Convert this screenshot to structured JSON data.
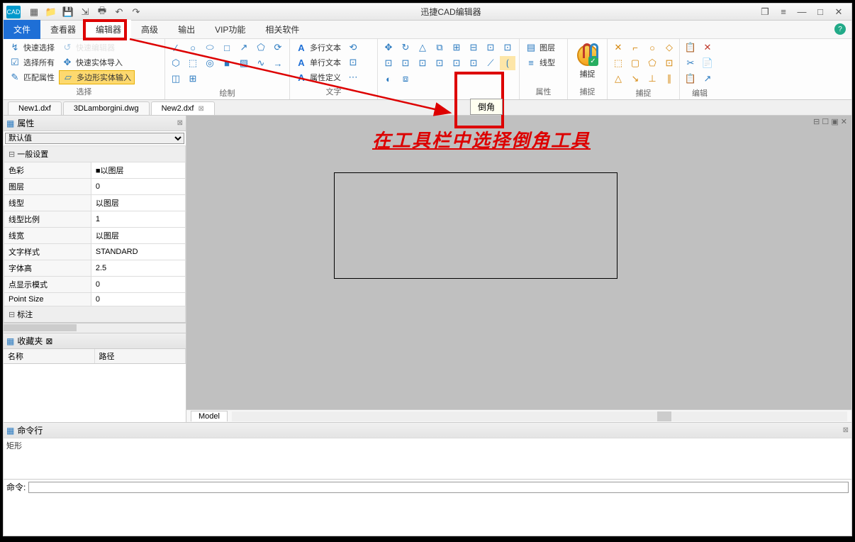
{
  "app": {
    "title": "迅捷CAD编辑器",
    "logo_text": "CAD"
  },
  "qat": [
    "new-icon",
    "open-icon",
    "save-icon",
    "export-icon",
    "print-icon",
    "undo-icon",
    "redo-icon"
  ],
  "win_controls": {
    "panel": "❐",
    "menu": "≡",
    "min": "—",
    "restore": "□",
    "close": "✕"
  },
  "menu": {
    "file": "文件",
    "tabs": [
      "查看器",
      "编辑器",
      "高级",
      "输出",
      "VIP功能",
      "相关软件"
    ],
    "active_index": 1
  },
  "ribbon": {
    "groups": [
      {
        "label": "选择",
        "items_col1": [
          {
            "icon": "↯",
            "text": "快速选择"
          },
          {
            "icon": "☑",
            "text": "选择所有"
          },
          {
            "icon": "✎",
            "text": "匹配属性"
          }
        ],
        "items_col2": [
          {
            "icon": "↺",
            "text": "",
            "dim": true
          },
          {
            "icon": "✥",
            "text": "快速实体导入"
          },
          {
            "icon": "▱",
            "text": "多边形实体输入",
            "selected": true
          }
        ]
      },
      {
        "label": "绘制",
        "icons": [
          "∕",
          "○",
          "⬭",
          "□",
          "↗",
          "⬠",
          "⟳",
          "⬡",
          "⬚",
          "⊗",
          "⬛",
          "▨",
          "∿",
          "∕",
          "◫",
          "⊞"
        ]
      },
      {
        "label": "文字",
        "items": [
          {
            "icon": "A",
            "text": "多行文本"
          },
          {
            "icon": "A",
            "text": "单行文本"
          },
          {
            "icon": "A",
            "text": "属性定义"
          }
        ],
        "side_icons": [
          "⟲",
          "⊡",
          "⋯"
        ]
      },
      {
        "label": "",
        "icons": [
          "✥",
          "↻",
          "⟲",
          "⧉",
          "⊡",
          "⊞",
          "⊟",
          "⊡",
          "⊡",
          "⊡",
          "∕",
          "⟋",
          "⊡",
          "⊡",
          "⊡",
          "⟮",
          "◐",
          "⧈"
        ]
      },
      {
        "label": "属性",
        "items": [
          {
            "icon": "▤",
            "text": "图层"
          },
          {
            "icon": "≡",
            "text": "线型"
          }
        ]
      },
      {
        "label": "捕捉",
        "big_label": "捕捉"
      },
      {
        "label": "捕捉",
        "icons": [
          "✕",
          "⌐",
          "○",
          "◇",
          "⬚",
          "▢",
          "⬠",
          "⊡",
          "△",
          "↘",
          "⊥",
          "∥"
        ]
      },
      {
        "label": "编辑",
        "icons": [
          "📋",
          "✕",
          "✂",
          "📄",
          "📋",
          "↗"
        ]
      }
    ]
  },
  "tooltip": {
    "text": "倒角"
  },
  "filetabs": [
    {
      "name": "New1.dxf",
      "active": false
    },
    {
      "name": "3DLamborgini.dwg",
      "active": false
    },
    {
      "name": "New2.dxf",
      "active": true
    }
  ],
  "properties_panel": {
    "title": "属性",
    "dropdown": "默认值",
    "group1_title": "一般设置",
    "rows": [
      {
        "k": "色彩",
        "v": "■以图层"
      },
      {
        "k": "图层",
        "v": "0"
      },
      {
        "k": "线型",
        "v": "以图层"
      },
      {
        "k": "线型比例",
        "v": "1"
      },
      {
        "k": "线宽",
        "v": "以图层"
      },
      {
        "k": "文字样式",
        "v": "STANDARD"
      },
      {
        "k": "字体高",
        "v": "2.5"
      },
      {
        "k": "点显示模式",
        "v": "0"
      },
      {
        "k": "Point Size",
        "v": "0"
      }
    ],
    "group2_title": "标注"
  },
  "favorites_panel": {
    "title": "收藏夹",
    "cols": [
      "名称",
      "路径"
    ]
  },
  "canvas": {
    "model_tab": "Model",
    "annotation_text": "在工具栏中选择倒角工具",
    "win_icons": "⊟ ☐ ▣ ✕"
  },
  "cmd": {
    "title": "命令行",
    "history": "矩形",
    "prompt_label": "命令:",
    "prompt_value": ""
  }
}
